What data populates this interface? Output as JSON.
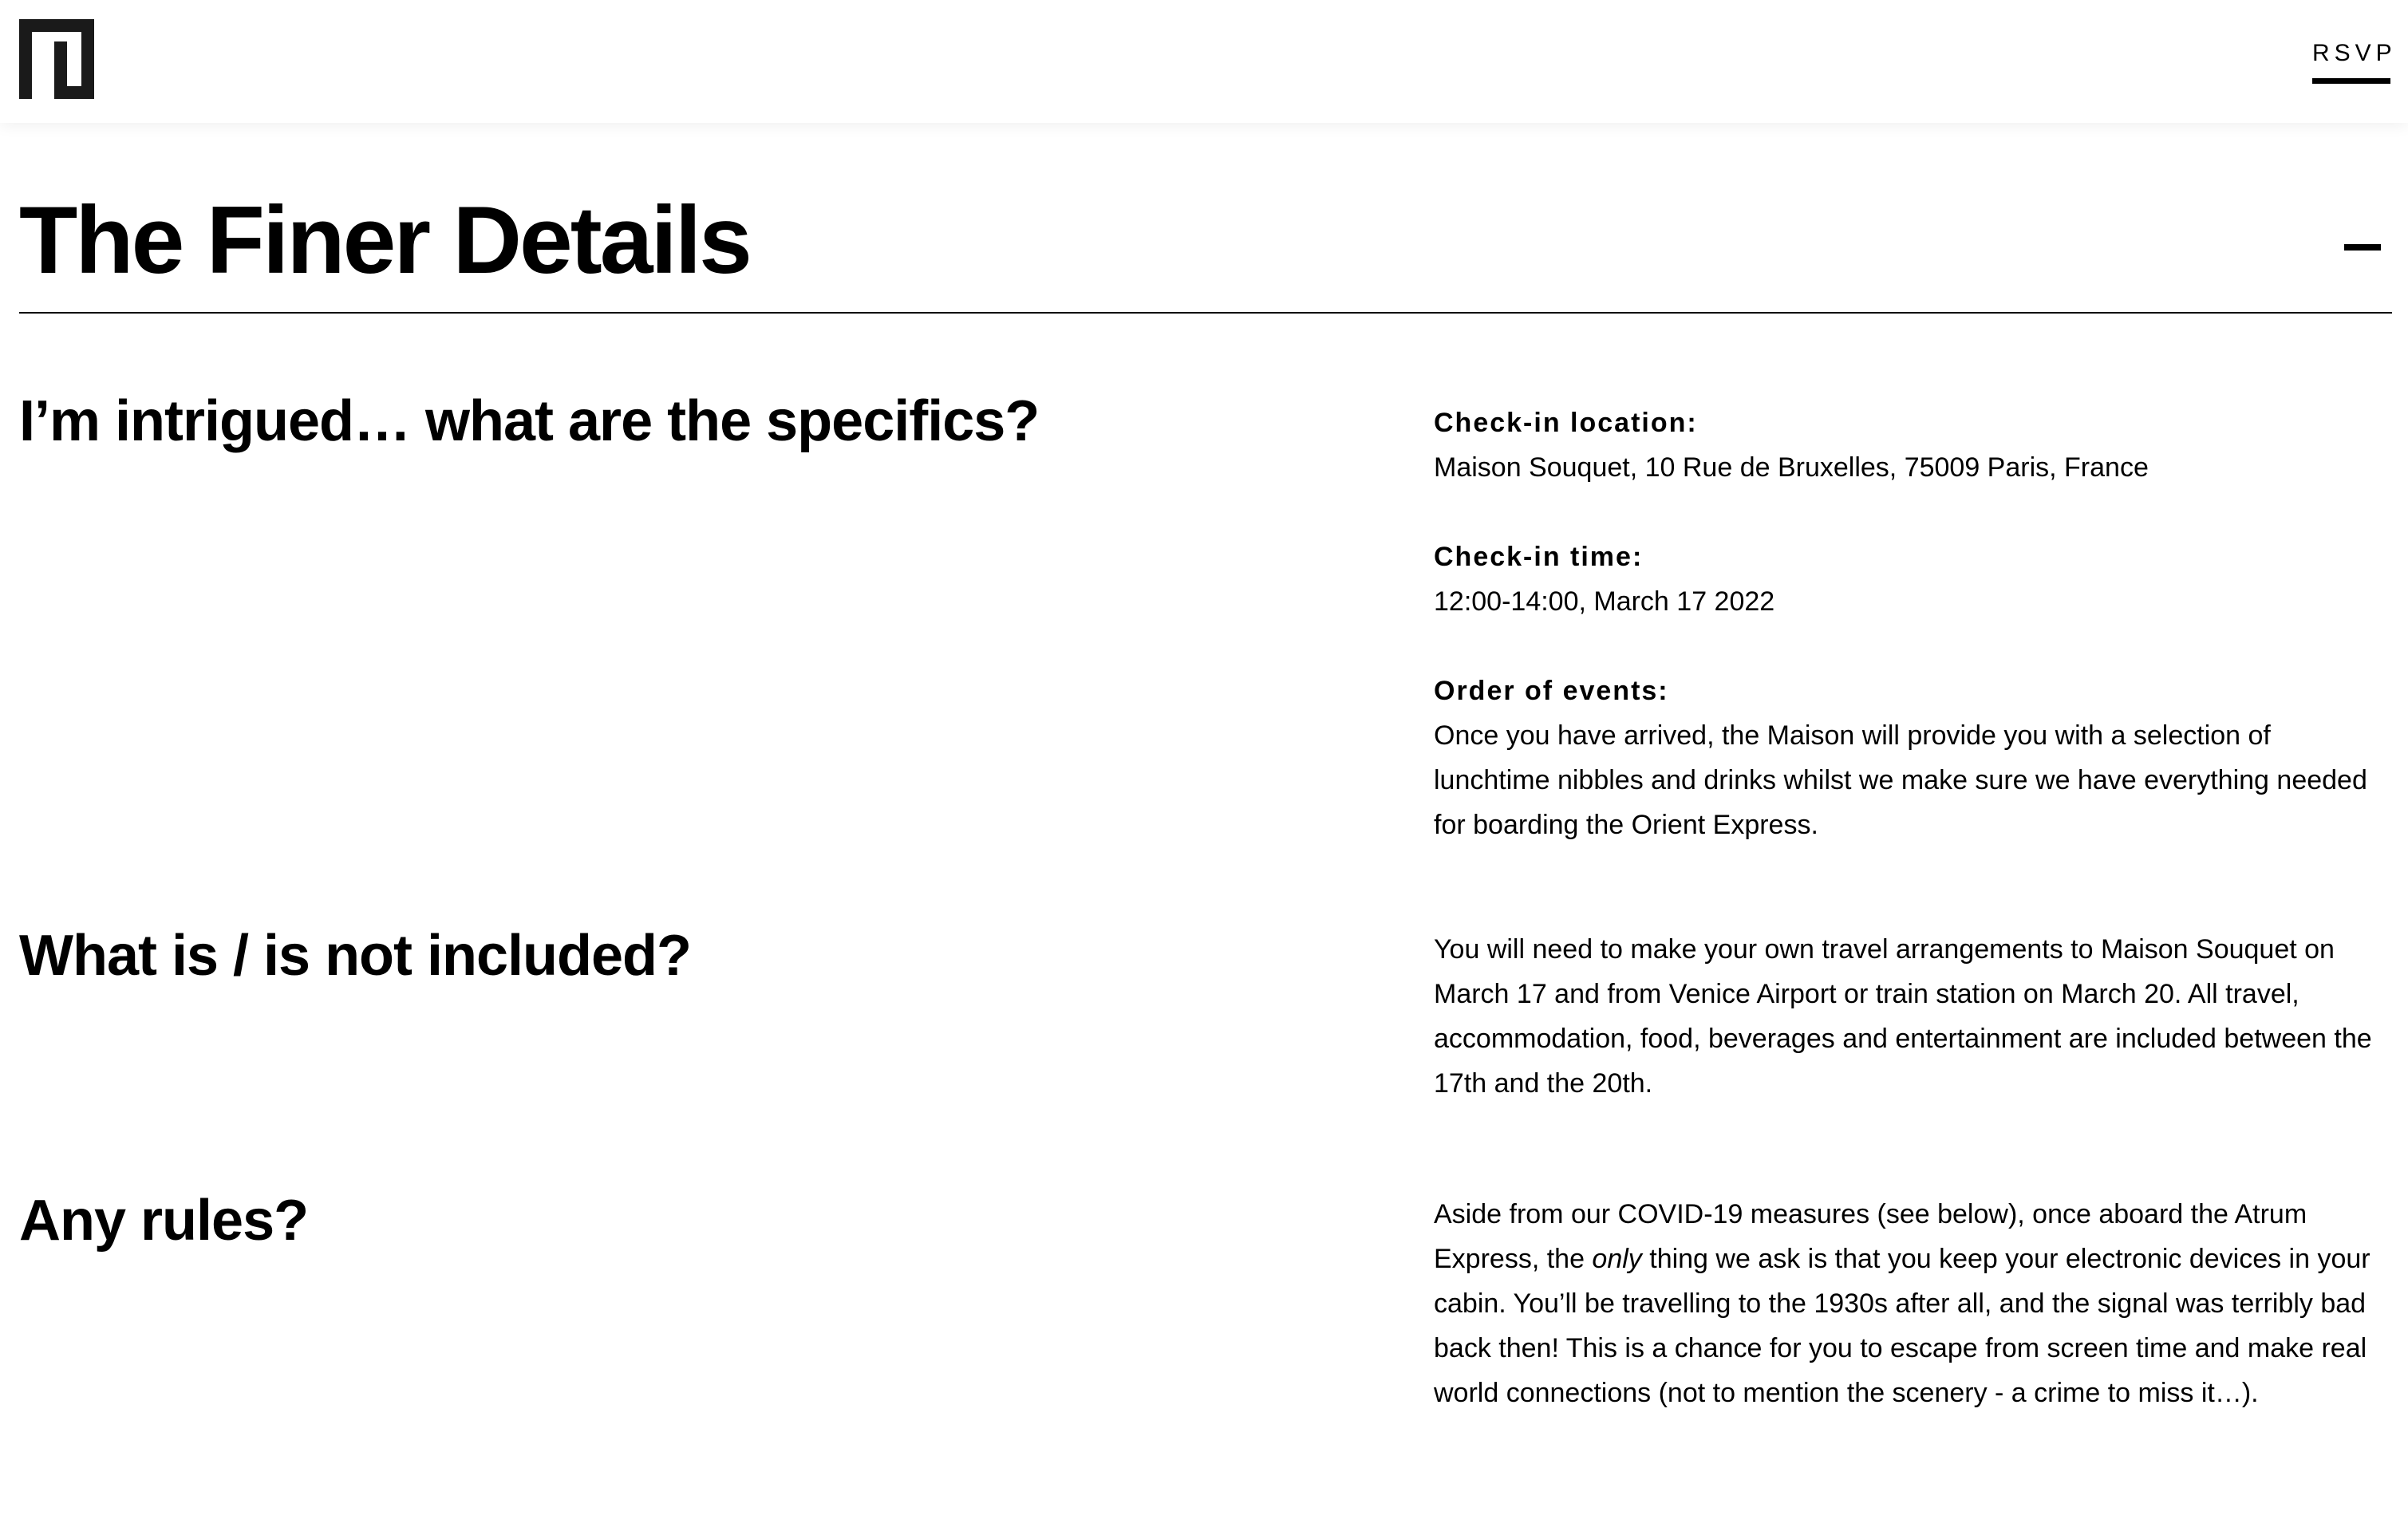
{
  "header": {
    "rsvp_label": "RSVP"
  },
  "section": {
    "title": "The Finer Details",
    "toggle_symbol": "–"
  },
  "specifics": {
    "heading": "I’m intrigued… what are the specifics?",
    "checkin_location_label": "Check-in location:",
    "checkin_location_value": "Maison Souquet, 10 Rue de Bruxelles, 75009 Paris, France",
    "checkin_time_label": "Check-in time:",
    "checkin_time_value": "12:00-14:00, March 17 2022",
    "order_label": "Order of events:",
    "order_value": "Once you have arrived, the Maison will provide you with a selection of lunchtime nibbles and drinks whilst we make sure we have everything needed for boarding the Orient Express."
  },
  "included": {
    "heading": "What is / is not included?",
    "body": "You will need to make your own travel arrangements to Maison Souquet on March 17 and from Venice Airport or train station on March 20. All travel, accommodation, food, beverages and entertainment are included between the 17th and the 20th."
  },
  "rules": {
    "heading": "Any rules?",
    "body_part1": "Aside from our COVID-19 measures (see below), once aboard the Atrum Express, the ",
    "body_emphasis": "only",
    "body_part2": " thing we ask is that you keep your electronic devices in your cabin. You’ll be travelling to the 1930s after all, and the signal was terribly bad back then! This is a chance for you to escape from screen time and make real world connections (not to mention the scenery - a crime to miss it…)."
  },
  "icons": {
    "logo": "square-bracket-logo-icon",
    "collapse": "minus-icon"
  }
}
